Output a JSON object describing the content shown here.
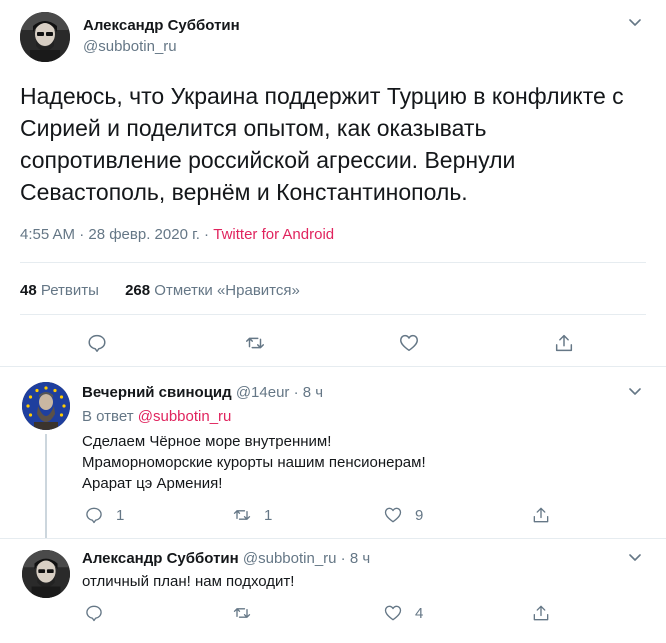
{
  "main_tweet": {
    "author_name": "Александр Субботин",
    "handle": "@subbotin_ru",
    "text": "Надеюсь, что Украина поддержит Турцию в конфликте с Сирией и поделится опытом, как оказывать сопротивление российской агрессии. Вернули Севастополь, вернём и Константинополь.",
    "time": "4:55 AM · 28 февр. 2020 г. · ",
    "source": "Twitter for Android",
    "retweets_count": "48",
    "retweets_label": " Ретвиты",
    "likes_count": "268",
    "likes_label": " Отметки «Нравится»",
    "actions": [
      "reply-icon",
      "retweet-icon",
      "like-icon",
      "share-icon"
    ]
  },
  "replies": [
    {
      "author_name": "Вечерний свиноцид",
      "handle": "@14eur",
      "time": " · 8 ч",
      "reply_to_label": "В ответ ",
      "reply_to_mention": "@subbotin_ru",
      "lines": [
        "Сделаем Чёрное море внутренним!",
        "Мраморноморские курорты нашим пенсионерам!",
        "Арарат цэ Армения!"
      ],
      "reply_count": "1",
      "retweet_count": "1",
      "like_count": "9"
    },
    {
      "author_name": "Александр Субботин",
      "handle": "@subbotin_ru",
      "time": " · 8 ч",
      "lines": [
        "отличный план! нам подходит!"
      ],
      "reply_count": "",
      "retweet_count": "",
      "like_count": "4"
    }
  ],
  "colors": {
    "text": "#14171a",
    "secondary": "#657786",
    "accent": "#e0245e",
    "divider": "#e6ecf0"
  }
}
